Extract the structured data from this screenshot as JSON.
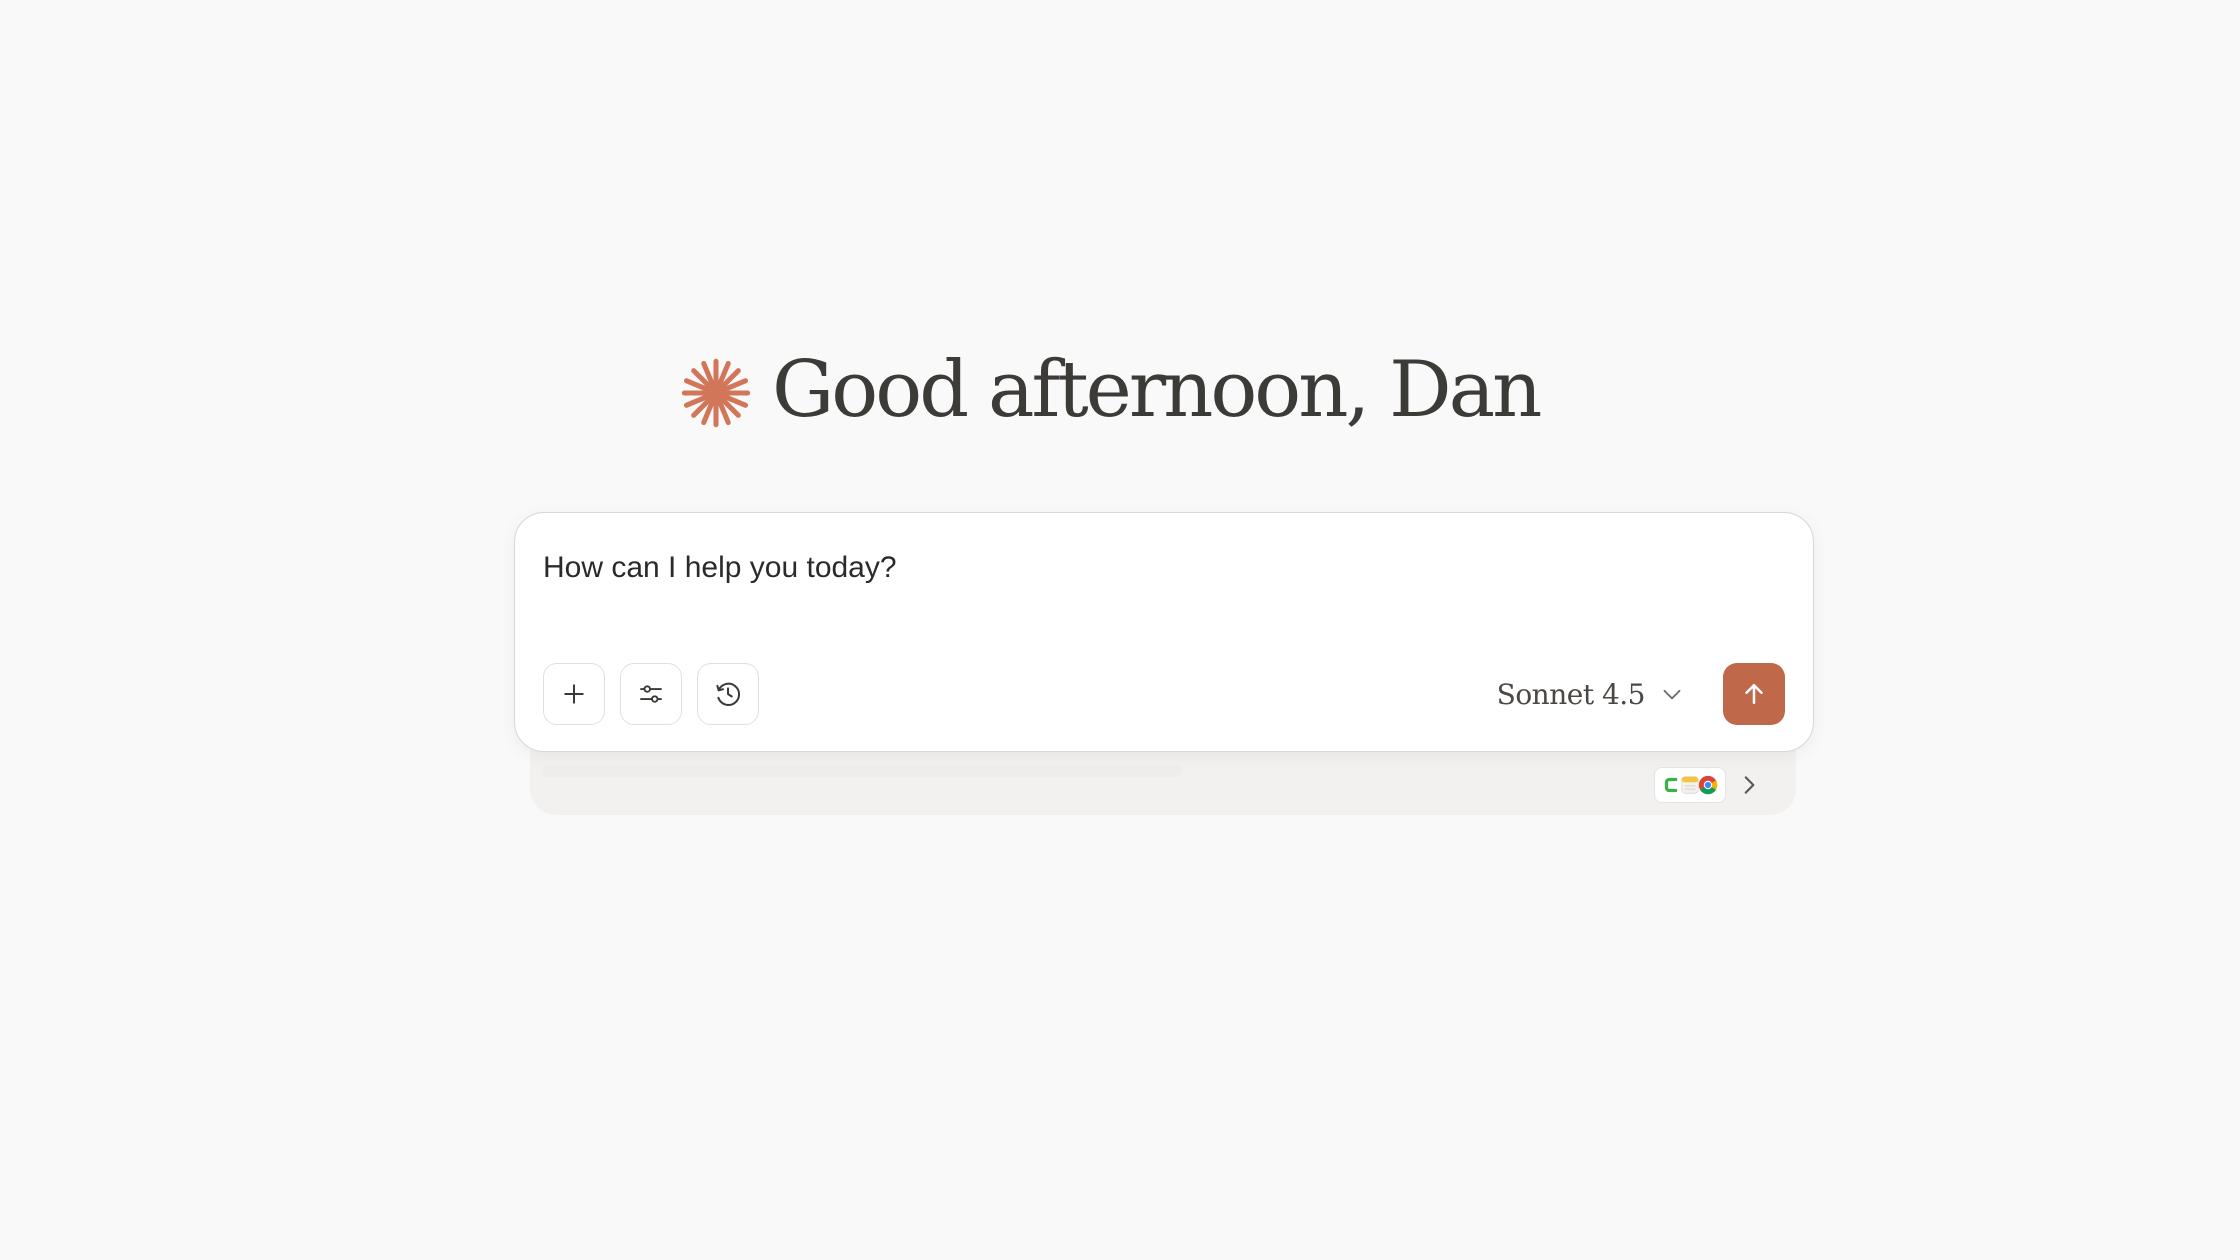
{
  "greeting": {
    "text": "Good afternoon, Dan",
    "icon": "spark-icon"
  },
  "composer": {
    "placeholder": "How can I help you today?",
    "tools": [
      {
        "name": "add-attachment",
        "icon": "plus-icon"
      },
      {
        "name": "settings",
        "icon": "sliders-icon"
      },
      {
        "name": "history",
        "icon": "clock-icon"
      }
    ],
    "model": {
      "label": "Sonnet 4.5",
      "icon": "chevron-down-icon"
    },
    "send": {
      "icon": "arrow-up-icon"
    }
  },
  "connected_apps": {
    "icons": [
      "green-app-icon",
      "notes-app-icon",
      "chrome-icon"
    ],
    "expand_icon": "chevron-right-icon"
  },
  "colors": {
    "background": "#faf9f9",
    "accent": "#c0694a",
    "text": "#3d3b38"
  }
}
